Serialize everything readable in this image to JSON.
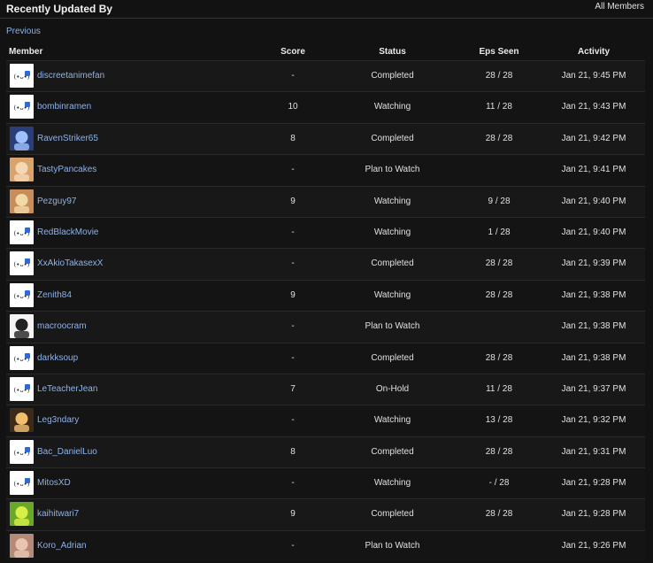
{
  "header": {
    "title": "Recently Updated By",
    "all_members_link": "All Members"
  },
  "nav": {
    "previous_link": "Previous"
  },
  "table": {
    "columns": [
      "Member",
      "Score",
      "Status",
      "Eps Seen",
      "Activity"
    ],
    "rows": [
      {
        "member": "discreetanimefan",
        "avatar": "default-avatar-icon",
        "score": "-",
        "status": "Completed",
        "eps": "28 / 28",
        "activity": "Jan 21, 9:45 PM"
      },
      {
        "member": "bombinramen",
        "avatar": "default-avatar-icon",
        "score": "10",
        "status": "Watching",
        "eps": "11 / 28",
        "activity": "Jan 21, 9:43 PM"
      },
      {
        "member": "RavenStriker65",
        "avatar": "user-avatar-image",
        "score": "8",
        "status": "Completed",
        "eps": "28 / 28",
        "activity": "Jan 21, 9:42 PM"
      },
      {
        "member": "TastyPancakes",
        "avatar": "user-avatar-image",
        "score": "-",
        "status": "Plan to Watch",
        "eps": "",
        "activity": "Jan 21, 9:41 PM"
      },
      {
        "member": "Pezguy97",
        "avatar": "user-avatar-image",
        "score": "9",
        "status": "Watching",
        "eps": "9 / 28",
        "activity": "Jan 21, 9:40 PM"
      },
      {
        "member": "RedBlackMovie",
        "avatar": "default-avatar-icon",
        "score": "-",
        "status": "Watching",
        "eps": "1 / 28",
        "activity": "Jan 21, 9:40 PM"
      },
      {
        "member": "XxAkioTakasexX",
        "avatar": "default-avatar-icon",
        "score": "-",
        "status": "Completed",
        "eps": "28 / 28",
        "activity": "Jan 21, 9:39 PM"
      },
      {
        "member": "Zenith84",
        "avatar": "default-avatar-icon",
        "score": "9",
        "status": "Watching",
        "eps": "28 / 28",
        "activity": "Jan 21, 9:38 PM"
      },
      {
        "member": "macroocram",
        "avatar": "user-avatar-image",
        "score": "-",
        "status": "Plan to Watch",
        "eps": "",
        "activity": "Jan 21, 9:38 PM"
      },
      {
        "member": "darkksoup",
        "avatar": "default-avatar-icon",
        "score": "-",
        "status": "Completed",
        "eps": "28 / 28",
        "activity": "Jan 21, 9:38 PM"
      },
      {
        "member": "LeTeacherJean",
        "avatar": "default-avatar-icon",
        "score": "7",
        "status": "On-Hold",
        "eps": "11 / 28",
        "activity": "Jan 21, 9:37 PM"
      },
      {
        "member": "Leg3ndary",
        "avatar": "user-avatar-image",
        "score": "-",
        "status": "Watching",
        "eps": "13 / 28",
        "activity": "Jan 21, 9:32 PM"
      },
      {
        "member": "Bac_DanielLuo",
        "avatar": "default-avatar-icon",
        "score": "8",
        "status": "Completed",
        "eps": "28 / 28",
        "activity": "Jan 21, 9:31 PM"
      },
      {
        "member": "MitosXD",
        "avatar": "default-avatar-icon",
        "score": "-",
        "status": "Watching",
        "eps": "- / 28",
        "activity": "Jan 21, 9:28 PM"
      },
      {
        "member": "kaihitwari7",
        "avatar": "user-avatar-image",
        "score": "9",
        "status": "Completed",
        "eps": "28 / 28",
        "activity": "Jan 21, 9:28 PM"
      },
      {
        "member": "Koro_Adrian",
        "avatar": "user-avatar-image",
        "score": "-",
        "status": "Plan to Watch",
        "eps": "",
        "activity": "Jan 21, 9:26 PM"
      }
    ]
  },
  "colors": {
    "background": "#121212",
    "link": "#8fb2e8",
    "text": "#e0e0e0"
  }
}
